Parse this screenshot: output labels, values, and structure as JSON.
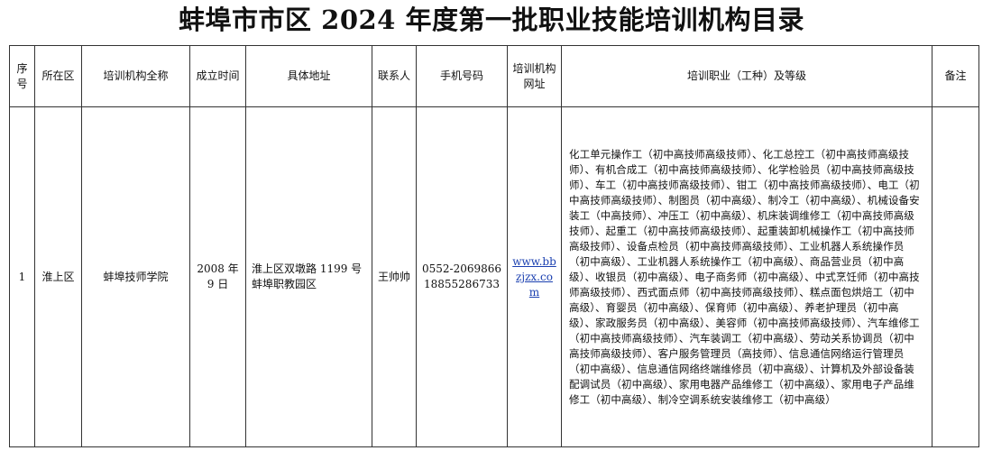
{
  "document": {
    "title": "蚌埠市市区 2024 年度第一批职业技能培训机构目录"
  },
  "table": {
    "headers": {
      "index": "序号",
      "district": "所在区",
      "org_name": "培训机构全称",
      "founded": "成立时间",
      "address": "具体地址",
      "contact": "联系人",
      "phone": "手机号码",
      "website": "培训机构网址",
      "occupations": "培训职业（工种）及等级",
      "remarks": "备注"
    },
    "rows": [
      {
        "index": "1",
        "district": "淮上区",
        "org_name": "蚌埠技师学院",
        "founded": "2008 年 9 日",
        "address": "淮上区双墩路 1199 号蚌埠职教园区",
        "contact": "王帅帅",
        "phone": "0552-2069866 18855286733",
        "website": "www.bbzjzx.com",
        "occupations": "化工单元操作工（初中高技师高级技师）、化工总控工（初中高技师高级技师）、有机合成工（初中高技师高级技师）、化学检验员（初中高技师高级技师）、车工（初中高技师高级技师）、钳工（初中高技师高级技师）、电工（初中高技师高级技师）、制图员（初中高级）、制冷工（初中高级）、机械设备安装工（中高技师）、冲压工（初中高级）、机床装调维修工（初中高技师高级技师）、起重工（初中高技师高级技师）、起重装卸机械操作工（初中高技师高级技师）、设备点检员（初中高技师高级技师）、工业机器人系统操作员（初中高级）、工业机器人系统操作工（初中高级）、商品营业员（初中高级）、收银员（初中高级）、电子商务师（初中高级）、中式烹饪师（初中高技师高级技师）、西式面点师（初中高技师高级技师）、糕点面包烘焙工（初中高级）、育婴员（初中高级）、保育师（初中高级）、养老护理员（初中高级）、家政服务员（初中高级）、美容师（初中高技师高级技师）、汽车维修工（初中高技师高级技师）、汽车装调工（初中高级）、劳动关系协调员（初中高技师高级技师）、客户服务管理员（高技师）、信息通信网络运行管理员（初中高级）、信息通信网络终端维修员（初中高级）、计算机及外部设备装配调试员（初中高级）、家用电器产品维修工（初中高级）、家用电子产品维修工（初中高级）、制冷空调系统安装维修工（初中高级）",
        "remarks": ""
      }
    ]
  }
}
